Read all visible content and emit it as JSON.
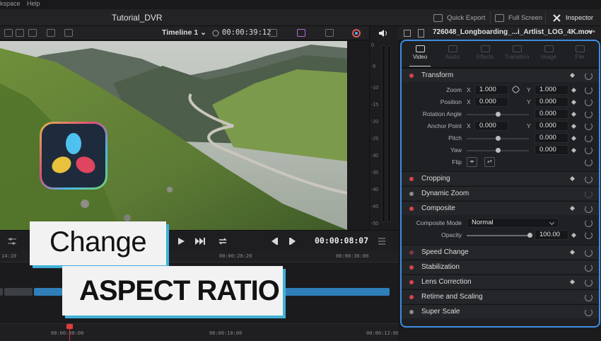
{
  "menu": {
    "workspace": "kspace",
    "help": "Help"
  },
  "app": {
    "title": "Tutorial_DVR"
  },
  "toolbar": {
    "quick_export": "Quick Export",
    "full_screen": "Full Screen",
    "inspector": "Inspector"
  },
  "viewer": {
    "timeline_name": "Timeline 1",
    "timecode_top": "00:00:39:12"
  },
  "meters": {
    "labels": [
      "0",
      "-5",
      "-10",
      "-15",
      "-20",
      "-25",
      "-30",
      "-35",
      "-40",
      "-45",
      "-50"
    ]
  },
  "transport": {
    "timecode": "00:00:08:07"
  },
  "timeline": {
    "ruler_top": [
      "14:10",
      "00:00:28:20",
      "00:00:36:00"
    ],
    "ruler_bottom": [
      "00:00:00:00",
      "00:00:10:00",
      "00:00:12:00"
    ]
  },
  "overlay": {
    "line1": "Change",
    "line2": "ASPECT RATIO"
  },
  "inspector": {
    "file_name": "726048_Longboarding_...i_Artlist_LOG_4K.mov",
    "tabs": [
      "Video",
      "Audio",
      "Effects",
      "Transition",
      "Image",
      "File"
    ],
    "transform": {
      "title": "Transform",
      "zoom_label": "Zoom",
      "zoom_x": "1.000",
      "zoom_y": "1.000",
      "position_label": "Position",
      "position_x": "0.000",
      "position_y": "0.000",
      "rotation_label": "Rotation Angle",
      "rotation": "0.000",
      "anchor_label": "Anchor Point",
      "anchor_x": "0.000",
      "anchor_y": "0.000",
      "pitch_label": "Pitch",
      "pitch": "0.000",
      "yaw_label": "Yaw",
      "yaw": "0.000",
      "flip_label": "Flip",
      "axis_x": "X",
      "axis_y": "Y"
    },
    "cropping": "Cropping",
    "dynamic_zoom": "Dynamic Zoom",
    "composite": {
      "title": "Composite",
      "mode_label": "Composite Mode",
      "mode_value": "Normal",
      "opacity_label": "Opacity",
      "opacity_value": "100.00"
    },
    "speed_change": "Speed Change",
    "stabilization": "Stabilization",
    "lens_correction": "Lens Correction",
    "retime_scaling": "Retime and Scaling",
    "super_scale": "Super Scale"
  },
  "colors": {
    "accent_blue": "#3e8de0",
    "playhead_red": "#e23b3b",
    "clip_blue": "#2f7fb8"
  }
}
